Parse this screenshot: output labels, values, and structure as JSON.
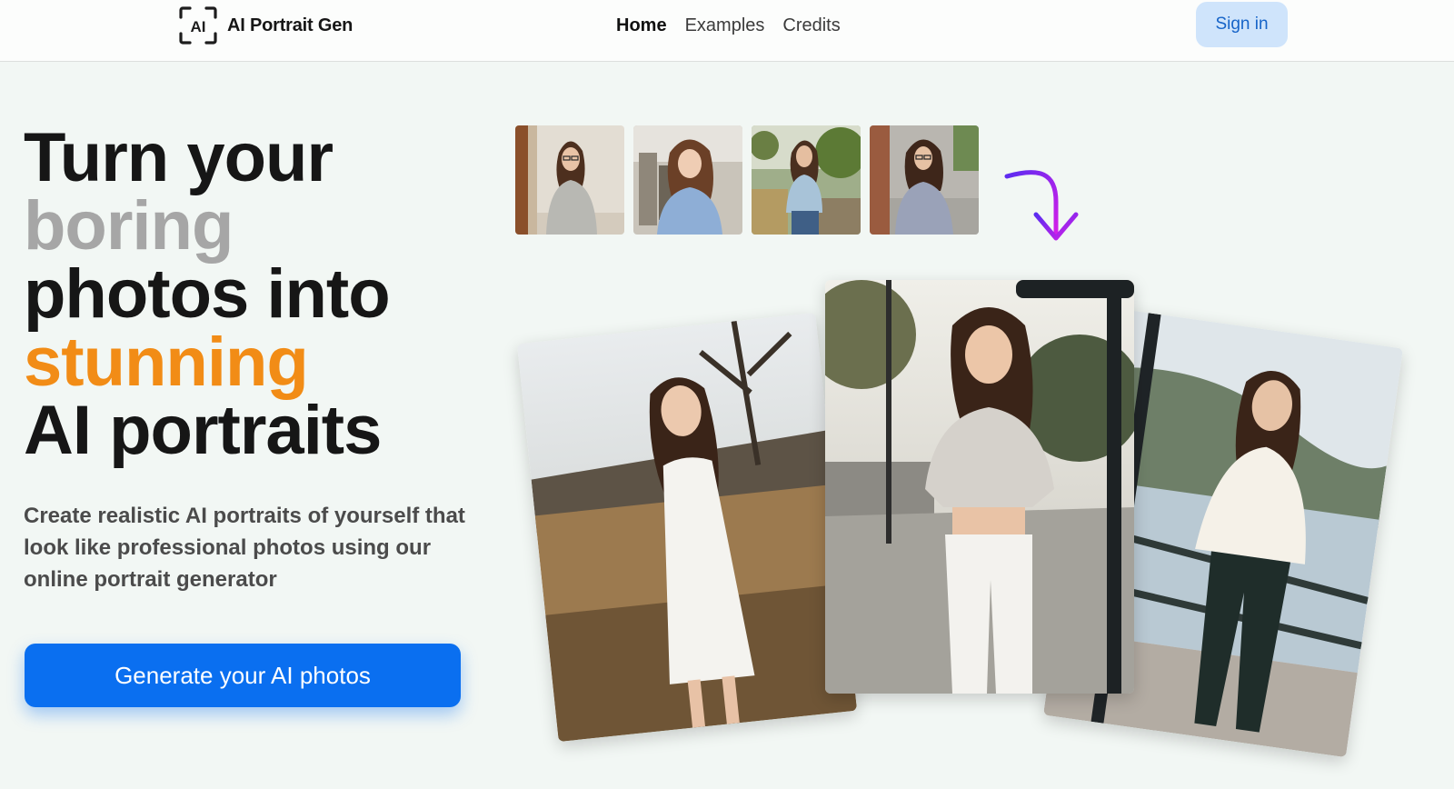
{
  "header": {
    "brand_mark": "AI",
    "brand_name": "AI Portrait Gen",
    "nav": [
      "Home",
      "Examples",
      "Credits"
    ],
    "active_nav": "Home",
    "signin_label": "Sign in"
  },
  "hero": {
    "headline_lines": [
      "Turn your",
      "boring",
      "photos into",
      "stunning",
      "AI portraits"
    ],
    "subtitle": "Create realistic AI portraits of yourself that look like professional photos using our online portrait generator",
    "cta_label": "Generate your AI photos"
  },
  "colors": {
    "background": "#f2f7f4",
    "primary": "#0a6ff0",
    "accent_orange": "#f28c16",
    "muted_gray": "#a6a6a6",
    "arrow_purple": "#b21ff0"
  },
  "icons": {
    "brand": "ai-scan-logo-icon",
    "arrow": "curved-arrow-down-icon"
  }
}
